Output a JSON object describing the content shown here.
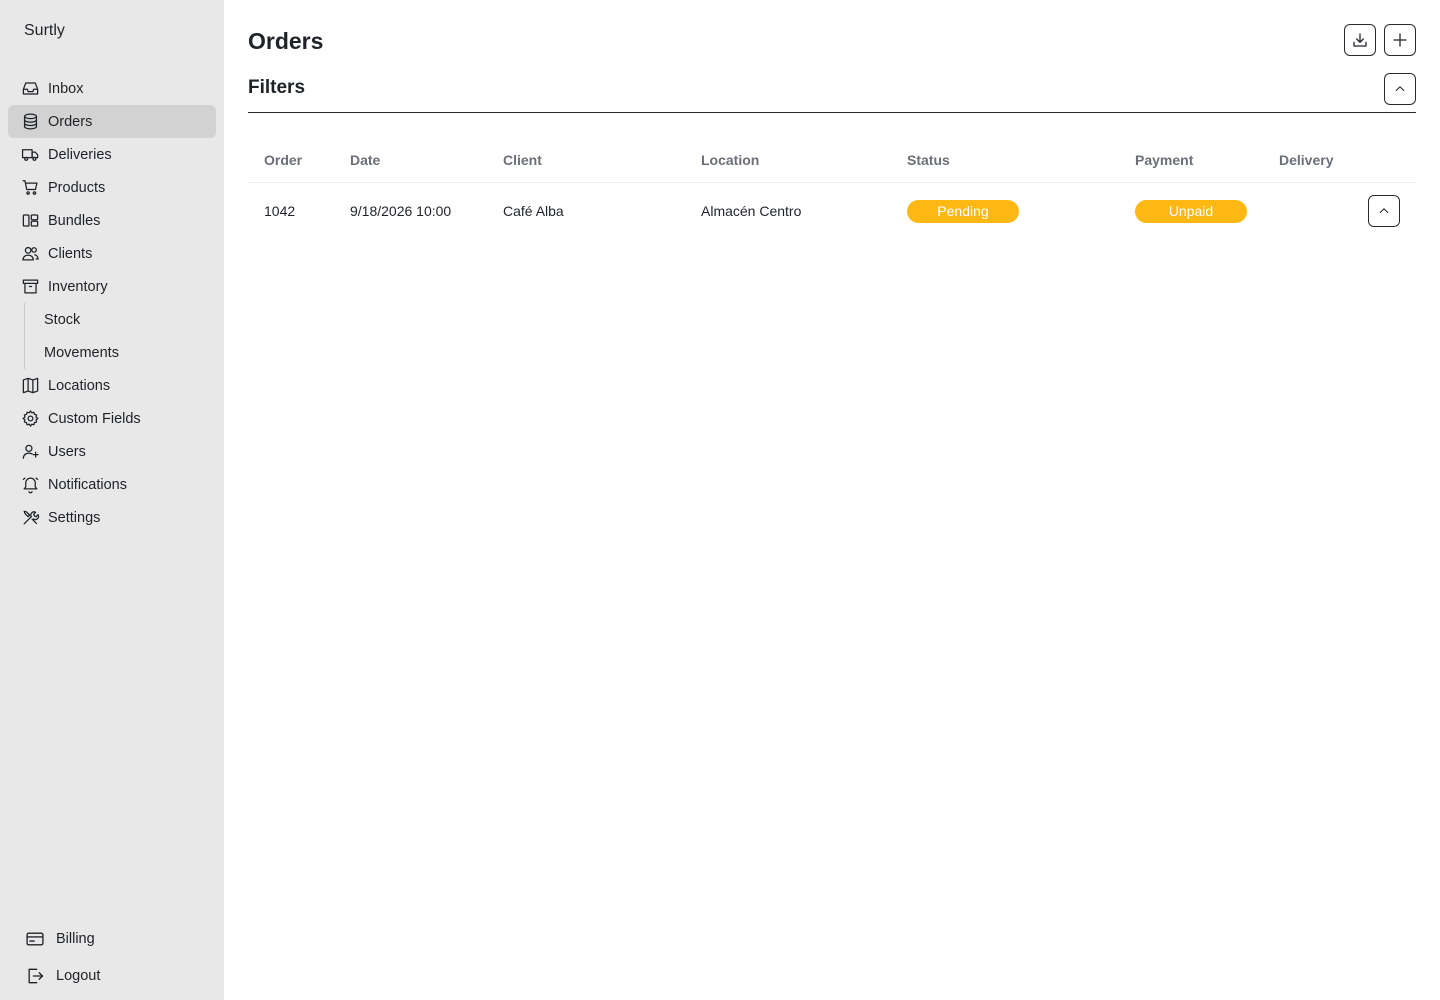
{
  "app": {
    "brand": "Surtly"
  },
  "sidebar": {
    "items": [
      {
        "label": "Inbox",
        "icon": "inbox-icon"
      },
      {
        "label": "Orders",
        "icon": "database-icon",
        "active": true
      },
      {
        "label": "Deliveries",
        "icon": "truck-icon"
      },
      {
        "label": "Products",
        "icon": "cart-icon"
      },
      {
        "label": "Bundles",
        "icon": "bundle-icon"
      },
      {
        "label": "Clients",
        "icon": "users-icon"
      },
      {
        "label": "Inventory",
        "icon": "archive-icon"
      }
    ],
    "inventory_sub": [
      {
        "label": "Stock"
      },
      {
        "label": "Movements"
      }
    ],
    "items2": [
      {
        "label": "Locations",
        "icon": "map-icon"
      },
      {
        "label": "Custom Fields",
        "icon": "cog-icon"
      },
      {
        "label": "Users",
        "icon": "user-plus-icon"
      },
      {
        "label": "Notifications",
        "icon": "bell-icon"
      },
      {
        "label": "Settings",
        "icon": "tools-icon"
      }
    ],
    "bottom": [
      {
        "label": "Billing",
        "icon": "credit-card-icon"
      },
      {
        "label": "Logout",
        "icon": "logout-icon"
      }
    ]
  },
  "main": {
    "title": "Orders",
    "filters_title": "Filters",
    "table": {
      "columns": [
        "Order",
        "Date",
        "Client",
        "Location",
        "Status",
        "Payment",
        "Delivery"
      ],
      "rows": [
        {
          "order": "1042",
          "date": "9/18/2026 10:00",
          "client": "Café Alba",
          "location": "Almacén Centro",
          "status": "Pending",
          "payment": "Unpaid",
          "delivery": ""
        }
      ]
    }
  },
  "colors": {
    "sidebar_bg": "#e8e8e8",
    "active_item_bg": "#d2d2d2",
    "badge": "#fdb813"
  }
}
